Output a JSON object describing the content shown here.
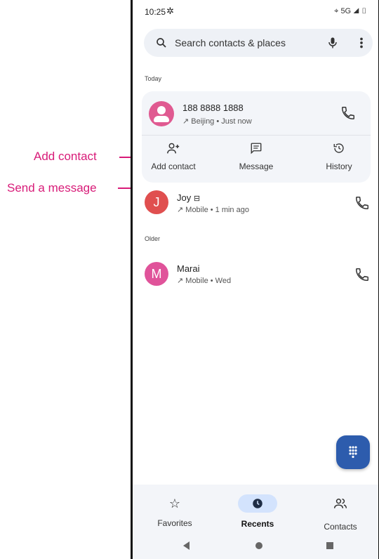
{
  "annotations": {
    "add_contact": "Add contact",
    "send_message": "Send a message"
  },
  "status_bar": {
    "time": "10:25",
    "right": "5G"
  },
  "search": {
    "placeholder": "Search contacts & places"
  },
  "sections": {
    "today": "Today",
    "older": "Older"
  },
  "expanded_call": {
    "number": "188 8888 1888",
    "detail": "Beijing • Just now",
    "actions": [
      {
        "label": "Add contact"
      },
      {
        "label": "Message"
      },
      {
        "label": "History"
      }
    ]
  },
  "calls": [
    {
      "initial": "J",
      "name": "Joy",
      "detail": "Mobile • 1 min ago",
      "color": "#e04f4f"
    },
    {
      "initial": "M",
      "name": "Marai",
      "detail": "Mobile • Wed",
      "color": "#e0539a"
    }
  ],
  "bottom_nav": [
    {
      "label": "Favorites"
    },
    {
      "label": "Recents"
    },
    {
      "label": "Contacts"
    }
  ],
  "colors": {
    "annotation": "#d81b78",
    "fab": "#2d5cad",
    "accent_pill": "#d3e3fd"
  }
}
